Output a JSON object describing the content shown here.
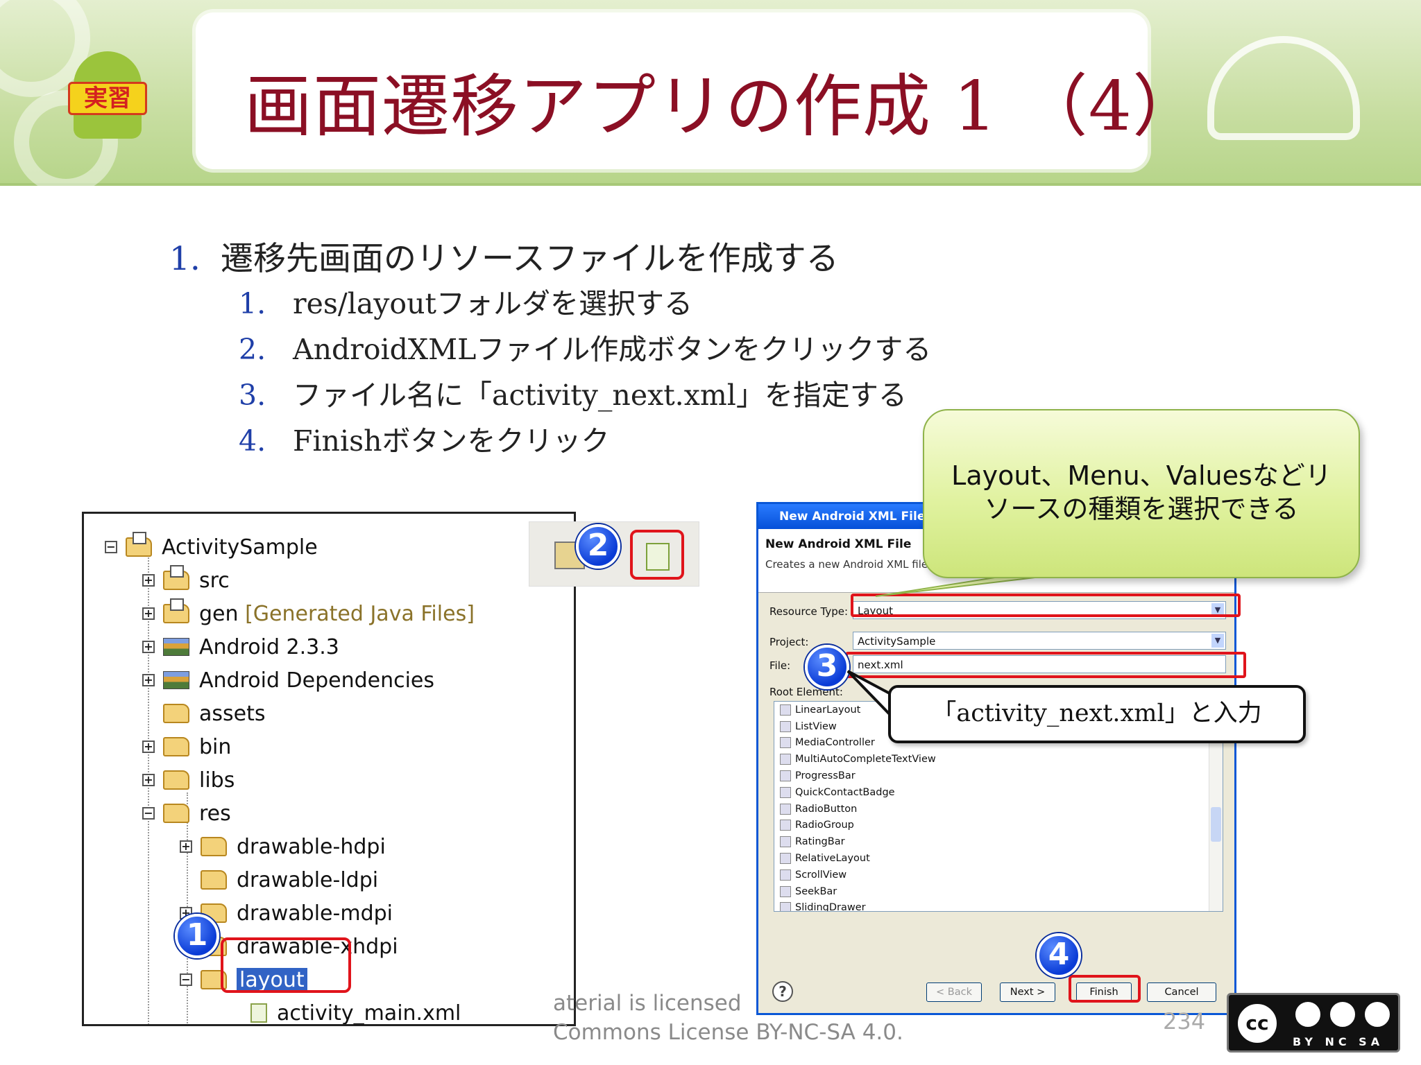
{
  "slide": {
    "title": "画面遷移アプリの作成 1 （4）",
    "badge": "実習"
  },
  "bullets": {
    "main": {
      "num": "1.",
      "text": "遷移先画面のリソースファイルを作成する"
    },
    "sub": [
      {
        "num": "1.",
        "text": "res/layoutフォルダを選択する"
      },
      {
        "num": "2.",
        "text": "AndroidXMLファイル作成ボタンをクリックする"
      },
      {
        "num": "3.",
        "text": "ファイル名に「activity_next.xml」を指定する"
      },
      {
        "num": "4.",
        "text": "Finishボタンをクリック"
      }
    ]
  },
  "tree": {
    "items": [
      {
        "label": "ActivitySample",
        "suffix": ""
      },
      {
        "label": "src",
        "suffix": ""
      },
      {
        "label": "gen",
        "suffix": "[Generated Java Files]"
      },
      {
        "label": "Android 2.3.3",
        "suffix": ""
      },
      {
        "label": "Android Dependencies",
        "suffix": ""
      },
      {
        "label": "assets",
        "suffix": ""
      },
      {
        "label": "bin",
        "suffix": ""
      },
      {
        "label": "libs",
        "suffix": ""
      },
      {
        "label": "res",
        "suffix": ""
      },
      {
        "label": "drawable-hdpi",
        "suffix": ""
      },
      {
        "label": "drawable-ldpi",
        "suffix": ""
      },
      {
        "label": "drawable-mdpi",
        "suffix": ""
      },
      {
        "label": "drawable-xhdpi",
        "suffix": ""
      },
      {
        "label": "layout",
        "suffix": ""
      },
      {
        "label": "activity_main.xml",
        "suffix": ""
      }
    ]
  },
  "steps": [
    "1",
    "2",
    "3",
    "4"
  ],
  "dialog": {
    "window_title": "New Android XML File",
    "header_title": "New Android XML File",
    "header_subtitle": "Creates a new Android XML file",
    "resource_type_label": "Resource Type:",
    "resource_type_value": "Layout",
    "project_label": "Project:",
    "project_value": "ActivitySample",
    "file_label": "File:",
    "file_value": "next.xml",
    "root_element_label": "Root Element:",
    "elements": [
      "LinearLayout",
      "ListView",
      "MediaController",
      "MultiAutoCompleteTextView",
      "ProgressBar",
      "QuickContactBadge",
      "RadioButton",
      "RadioGroup",
      "RatingBar",
      "RelativeLayout",
      "ScrollView",
      "SeekBar",
      "SlidingDrawer"
    ],
    "buttons": {
      "back": "< Back",
      "next": "Next >",
      "finish": "Finish",
      "cancel": "Cancel"
    }
  },
  "callouts": {
    "green_line1": "Layout、Menu、Valuesなどリ",
    "green_line2": "ソースの種類を選択できる",
    "white": "「activity_next.xml」と入力"
  },
  "footer": {
    "line1": "aterial is licensed",
    "line2": "Commons License BY-NC-SA 4.0.",
    "page": "234",
    "cc": "cc",
    "cc_codes": "BY NC SA"
  },
  "colors": {
    "title": "#8b0f24",
    "bullet_number": "#1f3fa8",
    "highlight": "#e0141b",
    "selection": "#3163c5"
  }
}
